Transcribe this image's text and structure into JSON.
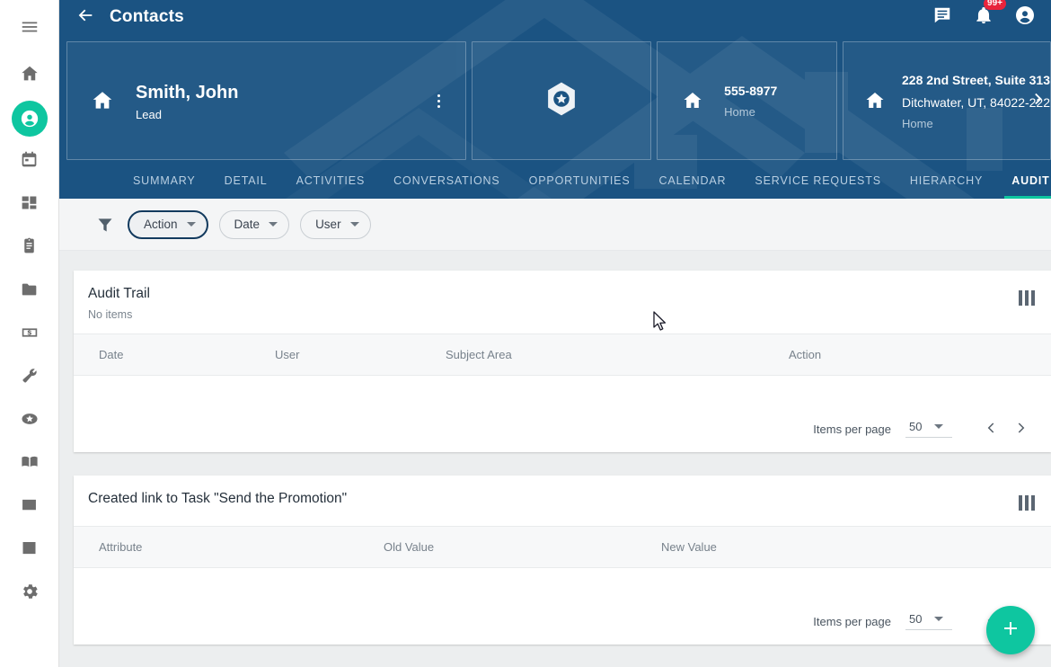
{
  "brand": {
    "header_blue": "#1b5382",
    "accent_teal": "#0ec6a0",
    "badge_red": "#e8243c",
    "page_bg": "#eceeef"
  },
  "rail": {
    "items": [
      {
        "name": "menu-icon",
        "label": "Menu"
      },
      {
        "name": "home-icon",
        "label": "Home"
      },
      {
        "name": "contacts-icon",
        "label": "Contacts"
      },
      {
        "name": "calendar-icon",
        "label": "Calendar"
      },
      {
        "name": "dashboard-icon",
        "label": "Dashboard"
      },
      {
        "name": "clipboard-icon",
        "label": "Tasks"
      },
      {
        "name": "folder-icon",
        "label": "Files"
      },
      {
        "name": "money-icon",
        "label": "Billing"
      },
      {
        "name": "wrench-icon",
        "label": "Service"
      },
      {
        "name": "star-badge-icon",
        "label": "Opportunities"
      },
      {
        "name": "book-icon",
        "label": "Knowledge"
      },
      {
        "name": "list-icon",
        "label": "Lists"
      },
      {
        "name": "chart-icon",
        "label": "Reports"
      },
      {
        "name": "gear-icon",
        "label": "Settings"
      }
    ],
    "active_index": 2
  },
  "topbar": {
    "back_label": "Back",
    "title": "Contacts",
    "messages_icon": "message-icon",
    "notifications_icon": "bell-icon",
    "notifications_badge": "99+",
    "account_icon": "account-icon"
  },
  "header_cards": {
    "name_card": {
      "icon": "home-icon",
      "name": "Smith, John",
      "status": "Lead",
      "more_label": "More options"
    },
    "badge_card": {
      "icon": "hexagon-star-icon"
    },
    "phone_card": {
      "icon": "home-icon",
      "value": "555-8977",
      "type": "Home"
    },
    "address_card": {
      "icon": "home-icon",
      "line1": "228 2nd Street, Suite 313",
      "line2": "Ditchwater, UT, 84022-222",
      "type": "Home",
      "next_label": "Next"
    }
  },
  "tabs": [
    {
      "label": "SUMMARY",
      "active": false
    },
    {
      "label": "DETAIL",
      "active": false
    },
    {
      "label": "ACTIVITIES",
      "active": false
    },
    {
      "label": "CONVERSATIONS",
      "active": false
    },
    {
      "label": "OPPORTUNITIES",
      "active": false
    },
    {
      "label": "CALENDAR",
      "active": false
    },
    {
      "label": "SERVICE REQUESTS",
      "active": false
    },
    {
      "label": "HIERARCHY",
      "active": false
    },
    {
      "label": "AUDIT TRAIL",
      "active": true
    }
  ],
  "filterbar": {
    "funnel_icon": "filter-icon",
    "chips": [
      {
        "label": "Action",
        "selected": true
      },
      {
        "label": "Date",
        "selected": false
      },
      {
        "label": "User",
        "selected": false
      }
    ]
  },
  "panels": [
    {
      "title": "Audit Trail",
      "subtitle": "No items",
      "columns_icon": "columns-icon",
      "columns": [
        "Date",
        "User",
        "Subject Area",
        "Action"
      ],
      "rows": [],
      "pager": {
        "items_per_page_label": "Items per page",
        "items_per_page_value": "50",
        "prev_label": "Previous page",
        "next_label": "Next page"
      }
    },
    {
      "title": "Created link to Task \"Send the Promotion\"",
      "subtitle": "",
      "columns_icon": "columns-icon",
      "columns": [
        "Attribute",
        "Old Value",
        "New Value"
      ],
      "rows": [],
      "pager": {
        "items_per_page_label": "Items per page",
        "items_per_page_value": "50",
        "prev_label": "Previous page",
        "next_label": "Next page"
      }
    }
  ],
  "fab": {
    "icon": "plus-icon",
    "label": "Add"
  }
}
